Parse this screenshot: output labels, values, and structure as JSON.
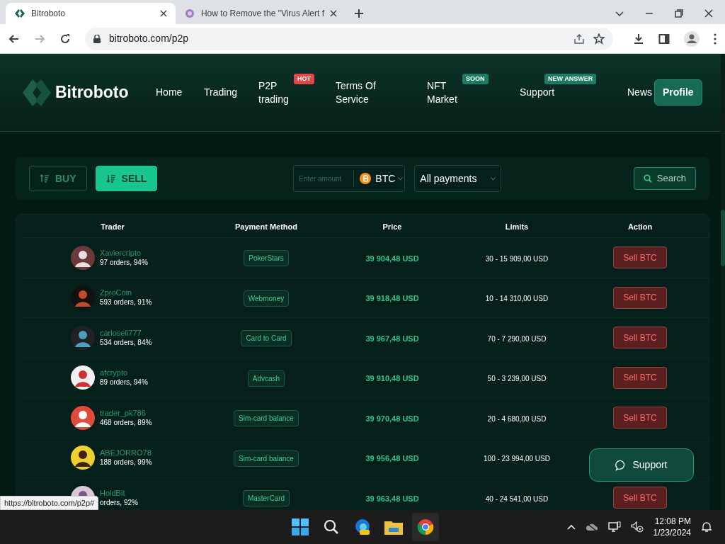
{
  "browser": {
    "tabs": [
      {
        "title": "Bitroboto",
        "selected": true
      },
      {
        "title": "How to Remove the \"Virus Alert f",
        "selected": false
      }
    ],
    "address": "bitroboto.com/p2p",
    "status_url": "https://bitroboto.com/p2p#"
  },
  "site": {
    "logo": "Bitroboto",
    "nav": [
      {
        "label": "Home"
      },
      {
        "label": "Trading"
      },
      {
        "label": "P2P trading",
        "badge": {
          "text": "HOT",
          "color": "#e04848"
        }
      },
      {
        "label": "Terms Of Service"
      },
      {
        "label": "NFT Market",
        "badge": {
          "text": "SOON",
          "color": "#1f7a62"
        }
      },
      {
        "label": "Support",
        "badge": {
          "text": "NEW ANSWER",
          "color": "#1f7a62"
        }
      },
      {
        "label": "News"
      }
    ],
    "profile": "Profile"
  },
  "filters": {
    "modes": [
      {
        "label": "BUY",
        "selected": false
      },
      {
        "label": "SELL",
        "selected": true
      }
    ],
    "amount": {
      "placeholder": "Enter amount"
    },
    "currency": "BTC",
    "payments": "All payments",
    "search": "Search"
  },
  "table": {
    "columns": [
      "Trader",
      "Payment Method",
      "Price",
      "Limits",
      "Action"
    ],
    "rows": [
      {
        "name": "Xaviercripto",
        "stats": "97 orders, 94%",
        "payment": "PokerStars",
        "price": "39 904,48 USD",
        "limits": "30 - 15 909,00 USD",
        "action": "Sell BTC"
      },
      {
        "name": "ZproCoin",
        "stats": "593 orders, 91%",
        "payment": "Webmoney",
        "price": "39 918,48 USD",
        "limits": "10 - 14 310,00 USD",
        "action": "Sell BTC"
      },
      {
        "name": "carloseli777",
        "stats": "534 orders, 84%",
        "payment": "Card to Card",
        "price": "39 967,48 USD",
        "limits": "70 - 7 290,00 USD",
        "action": "Sell BTC"
      },
      {
        "name": "afcrypto",
        "stats": "89 orders, 94%",
        "payment": "Advcash",
        "price": "39 910,48 USD",
        "limits": "50 - 3 239,00 USD",
        "action": "Sell BTC"
      },
      {
        "name": "trader_pk786",
        "stats": "468 orders, 89%",
        "payment": "Sim-card balance",
        "price": "39 970,48 USD",
        "limits": "20 - 4 680,00 USD",
        "action": "Sell BTC"
      },
      {
        "name": "ABEJORRO78",
        "stats": "188 orders, 99%",
        "payment": "Sim-card balance",
        "price": "39 956,48 USD",
        "limits": "100 - 23 994,00 USD"
      },
      {
        "name": "HoldBit",
        "stats": "orders, 92%",
        "payment": "MasterCard",
        "price": "39 963,48 USD",
        "limits": "40 - 24 541,00 USD",
        "action": "Sell BTC"
      }
    ]
  },
  "support_button": "Support",
  "taskbar": {
    "time": "12:08 PM",
    "date": "1/23/2024"
  }
}
